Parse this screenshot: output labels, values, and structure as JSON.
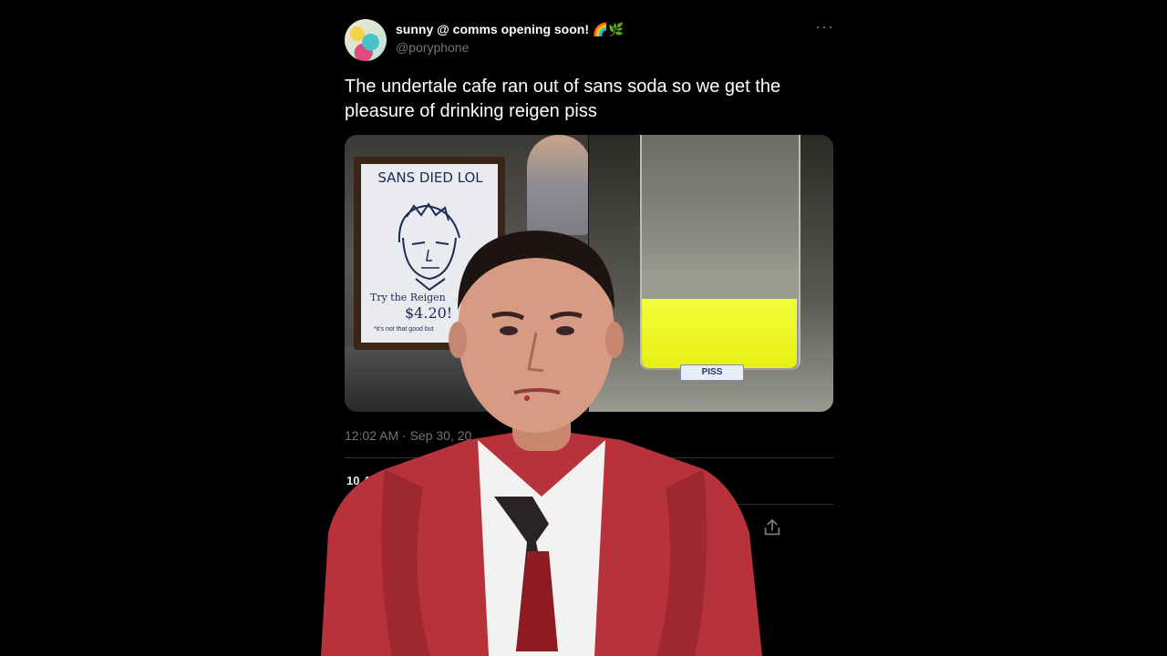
{
  "tweet": {
    "display_name": "sunny @ comms opening soon! 🌈🌿",
    "handle": "@poryphone",
    "more_icon": "ellipsis-icon",
    "text": "The undertale cafe ran out of sans soda so we get the pleasure of drinking reigen piss",
    "media": {
      "board_title": "SANS DIED LOL",
      "board_line": "Try the Reigen",
      "board_price": "$4.20!",
      "board_note": "*it's not that good but",
      "label": "PISS"
    },
    "timestamp": "12:02 AM · Sep 30, 20",
    "stats_partial": "10.4",
    "share_icon": "share-icon"
  },
  "overlay": {
    "icon": "man-in-red-suit-overlay"
  },
  "colors": {
    "background": "#000000",
    "text_primary": "#ffffff",
    "text_secondary": "#71767b",
    "suit": "#b8323c",
    "liquid": "#eef21f"
  }
}
